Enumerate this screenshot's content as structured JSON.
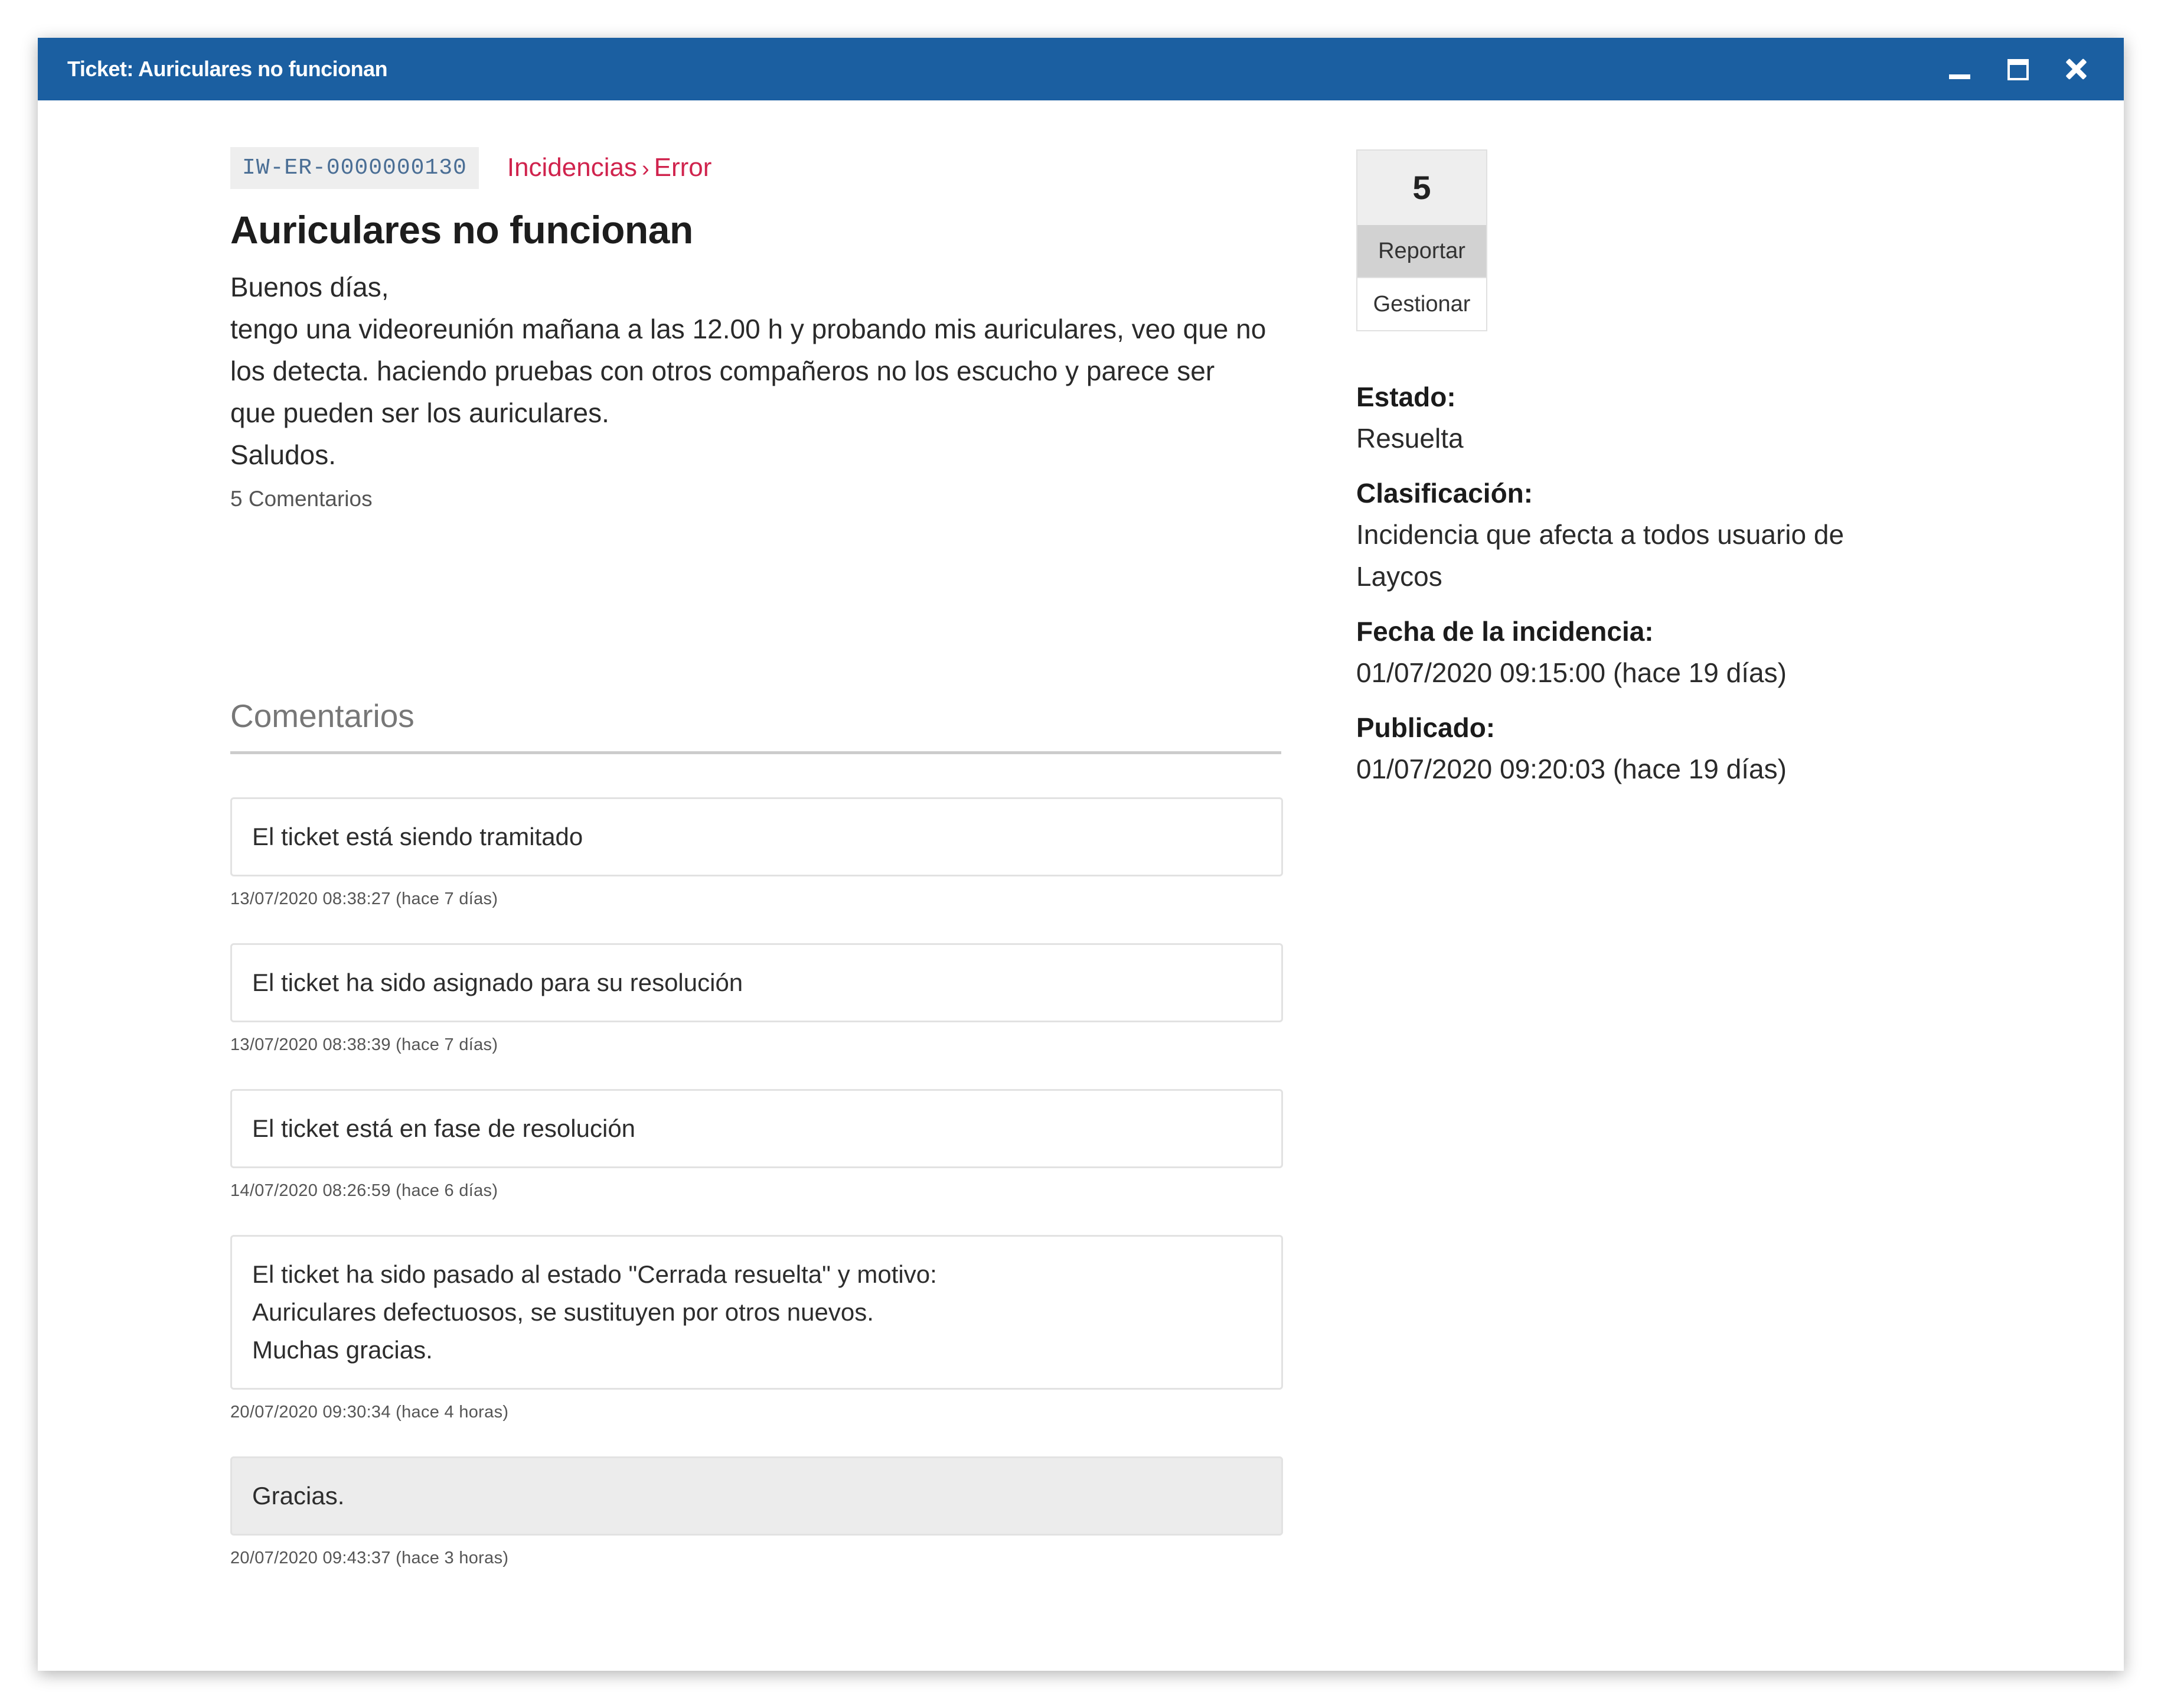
{
  "window": {
    "title": "Ticket: Auriculares no funcionan"
  },
  "ticket": {
    "id": "IW-ER-0000000130",
    "breadcrumb": [
      "Incidencias",
      "Error"
    ],
    "breadcrumb_separator": "›",
    "title": "Auriculares no funcionan",
    "description_lines": [
      "Buenos días,",
      "tengo una videoreunión mañana a las 12.00 h y probando mis auriculares, veo que no",
      "los detecta. haciendo pruebas con otros compañeros no los escucho y parece ser",
      "que pueden ser los auriculares.",
      "Saludos."
    ],
    "comments_count_label": "5 Comentarios"
  },
  "comments": {
    "header": "Comentarios",
    "items": [
      {
        "lines": [
          "El ticket está siendo tramitado"
        ],
        "date": "13/07/2020 08:38:27 (hace 7 días)"
      },
      {
        "lines": [
          "El ticket ha sido asignado para su resolución"
        ],
        "date": "13/07/2020 08:38:39 (hace 7 días)"
      },
      {
        "lines": [
          "El ticket está en fase de resolución"
        ],
        "date": "14/07/2020 08:26:59 (hace 6 días)"
      },
      {
        "lines": [
          "El ticket ha sido pasado al estado \"Cerrada resuelta\" y motivo:",
          "Auriculares defectuosos, se sustituyen por otros nuevos.",
          "Muchas gracias."
        ],
        "date": "20/07/2020 09:30:34 (hace 4 horas)"
      },
      {
        "lines": [
          "Gracias."
        ],
        "date": "20/07/2020 09:43:37 (hace 3 horas)"
      }
    ]
  },
  "sidebar": {
    "vote_count": "5",
    "report_label": "Reportar",
    "manage_label": "Gestionar",
    "fields": [
      {
        "label": "Estado:",
        "value_lines": [
          "Resuelta"
        ]
      },
      {
        "label": "Clasificación:",
        "value_lines": [
          "Incidencia que afecta a todos usuario de",
          "Laycos"
        ]
      },
      {
        "label": "Fecha de la incidencia:",
        "value_lines": [
          "01/07/2020 09:15:00 (hace 19 días)"
        ]
      },
      {
        "label": "Publicado:",
        "value_lines": [
          "01/07/2020 09:20:03 (hace 19 días)"
        ]
      }
    ]
  },
  "colors": {
    "titlebar": "#1b5fa1",
    "breadcrumb": "#d0234d",
    "ticket_id_text": "#4a6e95"
  },
  "icons": {
    "minimize": "minimize-icon",
    "maximize": "maximize-icon",
    "close": "close-icon"
  }
}
